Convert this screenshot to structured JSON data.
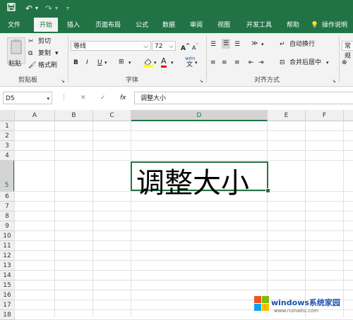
{
  "quick_access": {
    "save_icon": "save-icon",
    "undo_icon": "undo-icon",
    "redo_icon": "redo-icon",
    "customize_icon": "customize-icon"
  },
  "tabs": [
    "文件",
    "开始",
    "插入",
    "页面布局",
    "公式",
    "数据",
    "审阅",
    "视图",
    "开发工具",
    "帮助"
  ],
  "active_tab": "开始",
  "tell_me": "操作说明",
  "clipboard": {
    "paste": "粘贴",
    "cut": "剪切",
    "copy": "复制",
    "format_painter": "格式刷",
    "label": "剪贴板"
  },
  "font": {
    "name": "等线",
    "size": "72",
    "bold": "B",
    "italic": "I",
    "underline": "U",
    "grow": "A",
    "shrink": "A",
    "label": "字体",
    "wen": "wén",
    "wen_char": "文"
  },
  "alignment": {
    "wrap": "自动换行",
    "merge": "合并后居中",
    "label": "对齐方式"
  },
  "number": {
    "format": "常规"
  },
  "formula_bar": {
    "name_box": "D5",
    "cancel": "✕",
    "enter": "✓",
    "fx": "fx",
    "value": "调整大小"
  },
  "columns": [
    "A",
    "B",
    "C",
    "D",
    "E",
    "F"
  ],
  "selected_column": "D",
  "rows": [
    "1",
    "2",
    "3",
    "4",
    "5",
    "6",
    "7",
    "8",
    "9",
    "10",
    "11",
    "12",
    "13",
    "14",
    "15",
    "16",
    "17",
    "18"
  ],
  "selected_row": "5",
  "cell_D5": "调整大小",
  "watermark": {
    "title": "windows系统家园",
    "url": "www.ruinaitu.com"
  },
  "colors": {
    "accent": "#217346"
  }
}
